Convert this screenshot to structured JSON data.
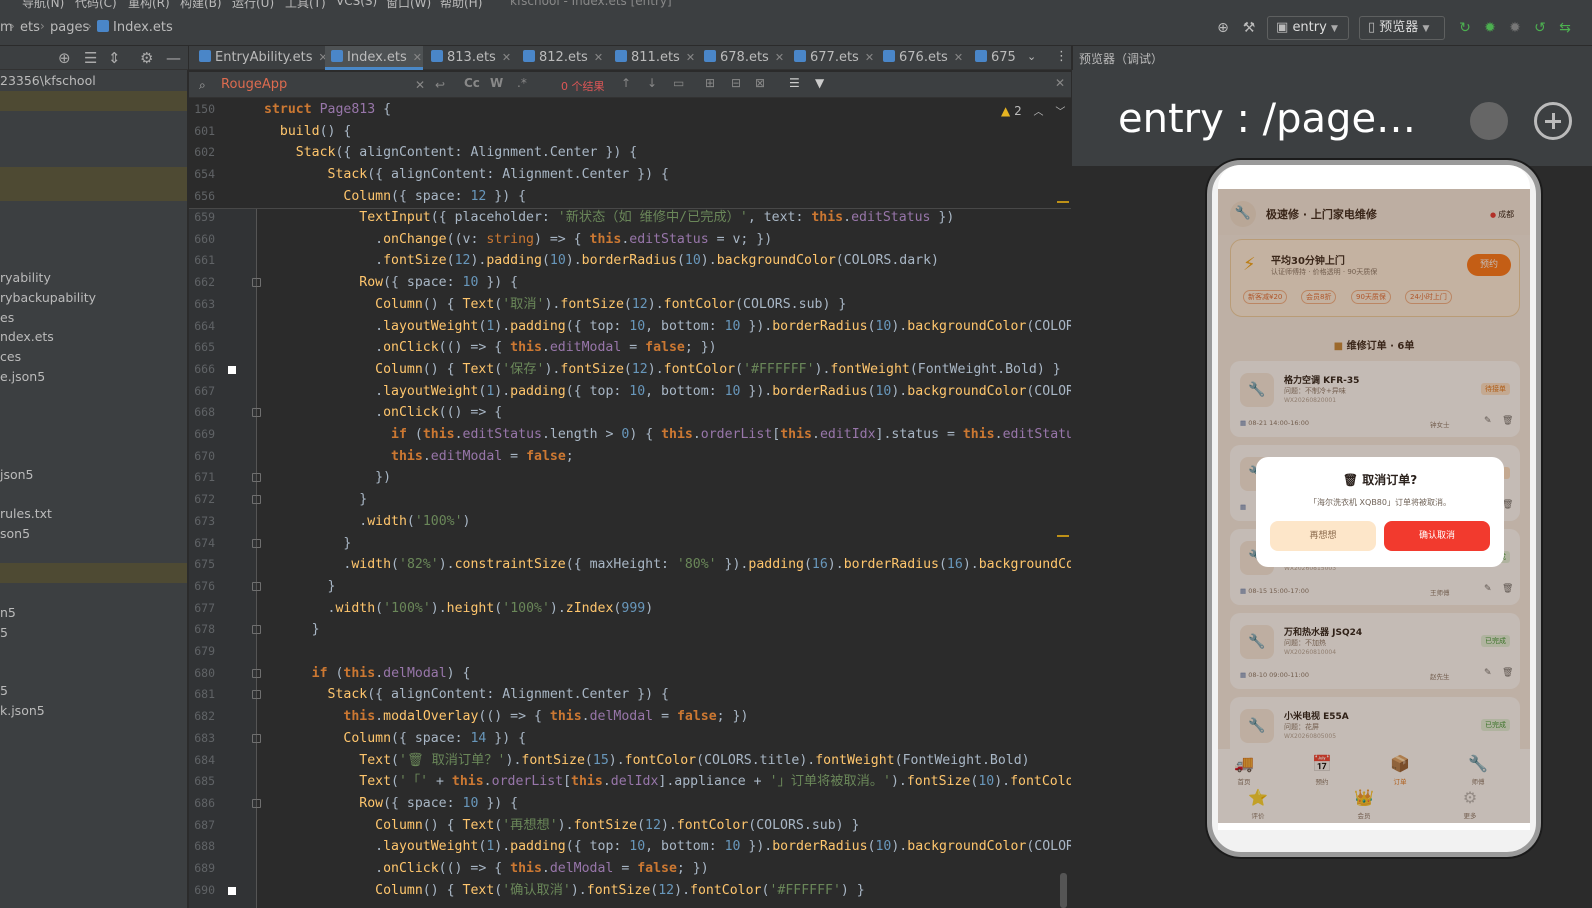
{
  "menubar": {
    "items": [
      "导航(N)",
      "代码(C)",
      "重构(R)",
      "构建(B)",
      "运行(U)",
      "工具(T)",
      "VCS(S)",
      "窗口(W)",
      "帮助(H)"
    ],
    "title": "kfschool - Index.ets [entry]"
  },
  "navbar": {
    "crumbs": [
      "m",
      "ets",
      "pages",
      "Index.ets"
    ],
    "run_config": "entry",
    "device": "预览器"
  },
  "project": {
    "path": "23356\\kfschool",
    "items": [
      {
        "label": "ryability",
        "hl": false
      },
      {
        "label": "rybackupability",
        "hl": false
      },
      {
        "label": "es",
        "hl": false
      },
      {
        "label": "ndex.ets",
        "hl": false
      },
      {
        "label": "ces",
        "hl": false
      },
      {
        "label": "e.json5",
        "hl": false
      },
      {
        "label": "json5",
        "hl": false
      },
      {
        "label": "rules.txt",
        "hl": false
      },
      {
        "label": "son5",
        "hl": false
      },
      {
        "label": "n5",
        "hl": false
      },
      {
        "label": "5",
        "hl": false
      },
      {
        "label": "5",
        "hl": false
      },
      {
        "label": "k.json5",
        "hl": false
      }
    ]
  },
  "tabs": [
    {
      "label": "EntryAbility.ets",
      "active": false
    },
    {
      "label": "Index.ets",
      "active": true
    },
    {
      "label": "813.ets",
      "active": false
    },
    {
      "label": "812.ets",
      "active": false
    },
    {
      "label": "811.ets",
      "active": false
    },
    {
      "label": "678.ets",
      "active": false
    },
    {
      "label": "677.ets",
      "active": false
    },
    {
      "label": "676.ets",
      "active": false
    },
    {
      "label": "675",
      "active": false
    }
  ],
  "search": {
    "query": "RougeApp",
    "case_label": "Cc",
    "word_label": "W",
    "regex_label": ".*",
    "results": "0 个结果"
  },
  "editor": {
    "warnings": "2",
    "sticky_lines": [
      {
        "ln": "150",
        "html": "<span class=\"kw\">struct</span> <span class=\"cls\" style=\"color:#9876aa\">Page813</span> {"
      },
      {
        "ln": "601",
        "html": "  <span class=\"fn\">build</span>() {"
      },
      {
        "ln": "602",
        "html": "    <span class=\"fn\">Stack</span>({ alignContent: Alignment.Center }) {"
      },
      {
        "ln": "654",
        "html": "        <span class=\"fn\">Stack</span>({ alignContent: Alignment.Center }) {"
      },
      {
        "ln": "656",
        "html": "          <span class=\"fn\">Column</span>({ space: <span class=\"num\">12</span> }) {"
      }
    ],
    "lines": [
      {
        "ln": "659",
        "html": "            <span class=\"fn\">TextInput</span>({ placeholder: <span class=\"str\">'新状态（如 维修中/已完成）'</span>, text: <span class=\"kw\">this</span>.<span class=\"prop\">editStatus</span> })"
      },
      {
        "ln": "660",
        "html": "              .<span class=\"mth\">onChange</span>((v: <span class=\"type\">string</span>) => { <span class=\"kw\">this</span>.<span class=\"prop\">editStatus</span> = v; })"
      },
      {
        "ln": "661",
        "html": "              .<span class=\"mth\">fontSize</span>(<span class=\"num\">12</span>).<span class=\"mth\">padding</span>(<span class=\"num\">10</span>).<span class=\"mth\">borderRadius</span>(<span class=\"num\">10</span>).<span class=\"mth\">backgroundColor</span>(COLORS.dark)"
      },
      {
        "ln": "662",
        "html": "            <span class=\"fn\">Row</span>({ space: <span class=\"num\">10</span> }) {"
      },
      {
        "ln": "663",
        "html": "              <span class=\"fn\">Column</span>() { <span class=\"fn\">Text</span>(<span class=\"str\">'取消'</span>).<span class=\"mth\">fontSize</span>(<span class=\"num\">12</span>).<span class=\"mth\">fontColor</span>(COLORS.sub) }"
      },
      {
        "ln": "664",
        "html": "              .<span class=\"mth\">layoutWeight</span>(<span class=\"num\">1</span>).<span class=\"mth\">padding</span>({ top: <span class=\"num\">10</span>, bottom: <span class=\"num\">10</span> }).<span class=\"mth\">borderRadius</span>(<span class=\"num\">10</span>).<span class=\"mth\">backgroundColor</span>(COLORS"
      },
      {
        "ln": "665",
        "html": "              .<span class=\"mth\">onClick</span>(() => { <span class=\"kw\">this</span>.<span class=\"prop\">editModal</span> = <span class=\"kw\">false</span>; })"
      },
      {
        "ln": "666",
        "html": "              <span class=\"fn\">Column</span>() { <span class=\"fn\">Text</span>(<span class=\"str\">'保存'</span>).<span class=\"mth\">fontSize</span>(<span class=\"num\">12</span>).<span class=\"mth\">fontColor</span>(<span class=\"str\">'#FFFFFF'</span>).<span class=\"mth\">fontWeight</span>(FontWeight.Bold) }"
      },
      {
        "ln": "667",
        "html": "              .<span class=\"mth\">layoutWeight</span>(<span class=\"num\">1</span>).<span class=\"mth\">padding</span>({ top: <span class=\"num\">10</span>, bottom: <span class=\"num\">10</span> }).<span class=\"mth\">borderRadius</span>(<span class=\"num\">10</span>).<span class=\"mth\">backgroundColor</span>(COLORS"
      },
      {
        "ln": "668",
        "html": "              .<span class=\"mth\">onClick</span>(() => {"
      },
      {
        "ln": "669",
        "html": "                <span class=\"kw\">if</span> (<span class=\"kw\">this</span>.<span class=\"prop\">editStatus</span>.length > <span class=\"num\">0</span>) { <span class=\"kw\">this</span>.<span class=\"prop\">orderList</span>[<span class=\"kw\">this</span>.<span class=\"prop\">editIdx</span>].status = <span class=\"kw\">this</span>.<span class=\"prop\">editStatus</span>"
      },
      {
        "ln": "670",
        "html": "                <span class=\"kw\">this</span>.<span class=\"prop\">editModal</span> = <span class=\"kw\">false</span>;"
      },
      {
        "ln": "671",
        "html": "              })"
      },
      {
        "ln": "672",
        "html": "            }"
      },
      {
        "ln": "673",
        "html": "            .<span class=\"mth\">width</span>(<span class=\"str\">'100%'</span>)"
      },
      {
        "ln": "674",
        "html": "          }"
      },
      {
        "ln": "675",
        "html": "          .<span class=\"mth\">width</span>(<span class=\"str\">'82%'</span>).<span class=\"mth\">constraintSize</span>({ maxHeight: <span class=\"str\">'80%'</span> }).<span class=\"mth\">padding</span>(<span class=\"num\">16</span>).<span class=\"mth\">borderRadius</span>(<span class=\"num\">16</span>).<span class=\"mth\">backgroundCo</span>"
      },
      {
        "ln": "676",
        "html": "        }"
      },
      {
        "ln": "677",
        "html": "        .<span class=\"mth\">width</span>(<span class=\"str\">'100%'</span>).<span class=\"mth\">height</span>(<span class=\"str\">'100%'</span>).<span class=\"mth\">zIndex</span>(<span class=\"num\">999</span>)"
      },
      {
        "ln": "678",
        "html": "      }"
      },
      {
        "ln": "679",
        "html": ""
      },
      {
        "ln": "680",
        "html": "      <span class=\"kw\">if</span> (<span class=\"kw\">this</span>.<span class=\"prop\">delModal</span>) {"
      },
      {
        "ln": "681",
        "html": "        <span class=\"fn\">Stack</span>({ alignContent: Alignment.Center }) {"
      },
      {
        "ln": "682",
        "html": "          <span class=\"kw\">this</span>.<span class=\"mth\">modalOverlay</span>(() => { <span class=\"kw\">this</span>.<span class=\"prop\">delModal</span> = <span class=\"kw\">false</span>; })"
      },
      {
        "ln": "683",
        "html": "          <span class=\"fn\">Column</span>({ space: <span class=\"num\">14</span> }) {"
      },
      {
        "ln": "684",
        "html": "            <span class=\"fn\">Text</span>(<span class=\"str\">'🗑 取消订单？'</span>).<span class=\"mth\">fontSize</span>(<span class=\"num\">15</span>).<span class=\"mth\">fontColor</span>(COLORS.title).<span class=\"mth\">fontWeight</span>(FontWeight.Bold)"
      },
      {
        "ln": "685",
        "html": "            <span class=\"fn\">Text</span>(<span class=\"str\">'「'</span> + <span class=\"kw\">this</span>.<span class=\"prop\">orderList</span>[<span class=\"kw\">this</span>.<span class=\"prop\">delIdx</span>].appliance + <span class=\"str\">'」订单将被取消。'</span>).<span class=\"mth\">fontSize</span>(<span class=\"num\">10</span>).<span class=\"mth\">fontColor</span>"
      },
      {
        "ln": "686",
        "html": "            <span class=\"fn\">Row</span>({ space: <span class=\"num\">10</span> }) {"
      },
      {
        "ln": "687",
        "html": "              <span class=\"fn\">Column</span>() { <span class=\"fn\">Text</span>(<span class=\"str\">'再想想'</span>).<span class=\"mth\">fontSize</span>(<span class=\"num\">12</span>).<span class=\"mth\">fontColor</span>(COLORS.sub) }"
      },
      {
        "ln": "688",
        "html": "              .<span class=\"mth\">layoutWeight</span>(<span class=\"num\">1</span>).<span class=\"mth\">padding</span>({ top: <span class=\"num\">10</span>, bottom: <span class=\"num\">10</span> }).<span class=\"mth\">borderRadius</span>(<span class=\"num\">10</span>).<span class=\"mth\">backgroundColor</span>(COLORS"
      },
      {
        "ln": "689",
        "html": "              .<span class=\"mth\">onClick</span>(() => { <span class=\"kw\">this</span>.<span class=\"prop\">delModal</span> = <span class=\"kw\">false</span>; })"
      },
      {
        "ln": "690",
        "html": "              <span class=\"fn\">Column</span>() { <span class=\"fn\">Text</span>(<span class=\"str\">'确认取消'</span>).<span class=\"mth\">fontSize</span>(<span class=\"num\">12</span>).<span class=\"mth\">fontColor</span>(<span class=\"str\">'#FFFFFF'</span>) }"
      }
    ]
  },
  "preview": {
    "title": "预览器（调试）",
    "path": "entry : /page…",
    "app": {
      "title": "极速修 · 上门家电维修",
      "location": "成都",
      "promo_title": "平均30分钟上门",
      "promo_sub": "认证师傅持 · 价格透明 · 90天质保",
      "promo_btn": "预约",
      "chips": [
        "新客减¥20",
        "会员8折",
        "90天质保",
        "24小时上门"
      ],
      "section_title": "维修订单 · 6单",
      "orders": [
        {
          "name": "格力空调 KFR-35",
          "issue": "问题：不制冷+异味",
          "no": "WX20260820001",
          "badge": "待接单",
          "status": "pending",
          "time": "08-21 14:00-16:00",
          "contact": "钟女士"
        },
        {
          "name": "",
          "issue": "",
          "no": "",
          "badge": "",
          "status": "pending",
          "time": "",
          "contact": ""
        },
        {
          "name": "",
          "issue": "",
          "no": "WX20260815003",
          "badge": "已完成",
          "status": "done",
          "time": "08-15 15:00-17:00",
          "contact": "王师傅"
        },
        {
          "name": "万和热水器 JSQ24",
          "issue": "问题：不加热",
          "no": "WX20260810004",
          "badge": "已完成",
          "status": "done",
          "time": "08-10 09:00-11:00",
          "contact": "赵先生"
        },
        {
          "name": "小米电视 E55A",
          "issue": "问题：花屏",
          "no": "WX20260805005",
          "badge": "已完成",
          "status": "done",
          "time": "",
          "contact": ""
        }
      ],
      "tabbar": [
        {
          "label": "首页",
          "icon": "🚚",
          "active": false
        },
        {
          "label": "预约",
          "icon": "📅",
          "active": false
        },
        {
          "label": "订单",
          "icon": "📦",
          "active": true
        },
        {
          "label": "师傅",
          "icon": "🔧",
          "active": false
        },
        {
          "label": "评价",
          "icon": "⭐",
          "active": false
        },
        {
          "label": "会员",
          "icon": "👑",
          "active": false
        },
        {
          "label": "更多",
          "icon": "⚙",
          "active": false
        }
      ],
      "modal": {
        "title": "🗑 取消订单?",
        "text": "「海尔洗衣机 XQB80」订单将被取消。",
        "cancel": "再想想",
        "confirm": "确认取消"
      }
    }
  }
}
